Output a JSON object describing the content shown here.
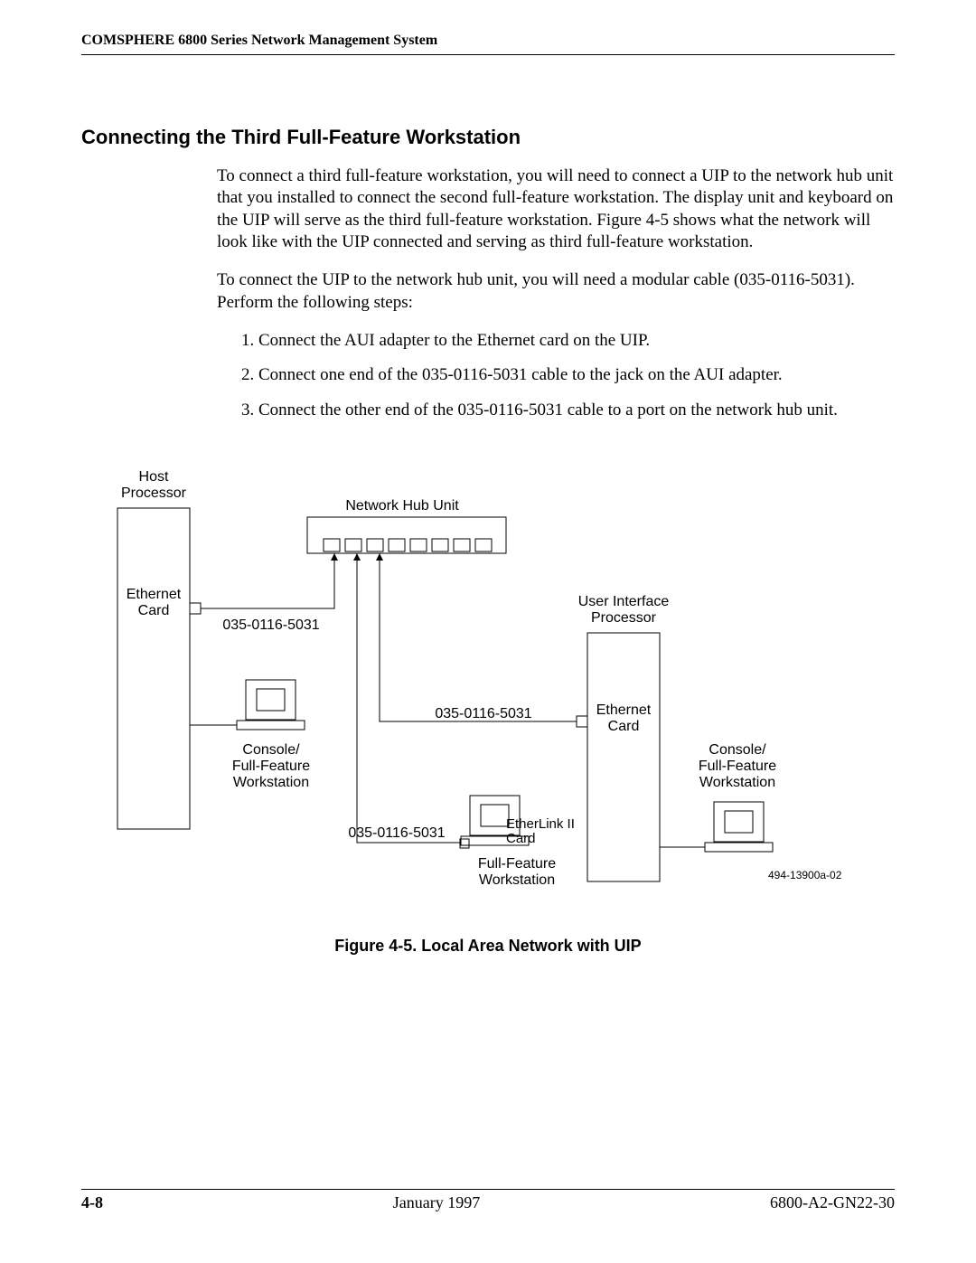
{
  "header": {
    "running_title": "COMSPHERE 6800 Series Network Management System"
  },
  "section": {
    "title": "Connecting the Third Full-Feature Workstation",
    "para1": "To connect a third full-feature workstation, you will need to connect a UIP to the network hub unit that you installed to connect the second full-feature workstation. The display unit and keyboard on the UIP will serve as the third full-feature workstation. Figure 4-5 shows what the network will look like with the UIP connected and serving as third full-feature workstation.",
    "para2": "To connect the UIP to the network hub unit, you will need a modular cable (035-0116-5031). Perform the following steps:",
    "steps": [
      "Connect the AUI adapter to the Ethernet card on the UIP.",
      "Connect one end of the 035-0116-5031 cable to the jack on the AUI adapter.",
      "Connect the other end of the 035-0116-5031 cable to a port on the network hub unit."
    ]
  },
  "figure": {
    "caption": "Figure 4-5.  Local Area Network with UIP",
    "labels": {
      "host_processor_line1": "Host",
      "host_processor_line2": "Processor",
      "ethernet_card_line1": "Ethernet",
      "ethernet_card_line2": "Card",
      "network_hub_unit": "Network Hub Unit",
      "cable_part_no": "035-0116-5031",
      "console_line1": "Console/",
      "console_line2": "Full-Feature",
      "console_line3": "Workstation",
      "uip_line1": "User Interface",
      "uip_line2": "Processor",
      "uip_eth_line1": "Ethernet",
      "uip_eth_line2": "Card",
      "etherlink_line1": "EtherLink II",
      "etherlink_line2": "Card",
      "ffw_line1": "Full-Feature",
      "ffw_line2": "Workstation",
      "drawing_no": "494-13900a-02"
    }
  },
  "footer": {
    "page_no": "4-8",
    "date": "January 1997",
    "doc_no": "6800-A2-GN22-30"
  }
}
